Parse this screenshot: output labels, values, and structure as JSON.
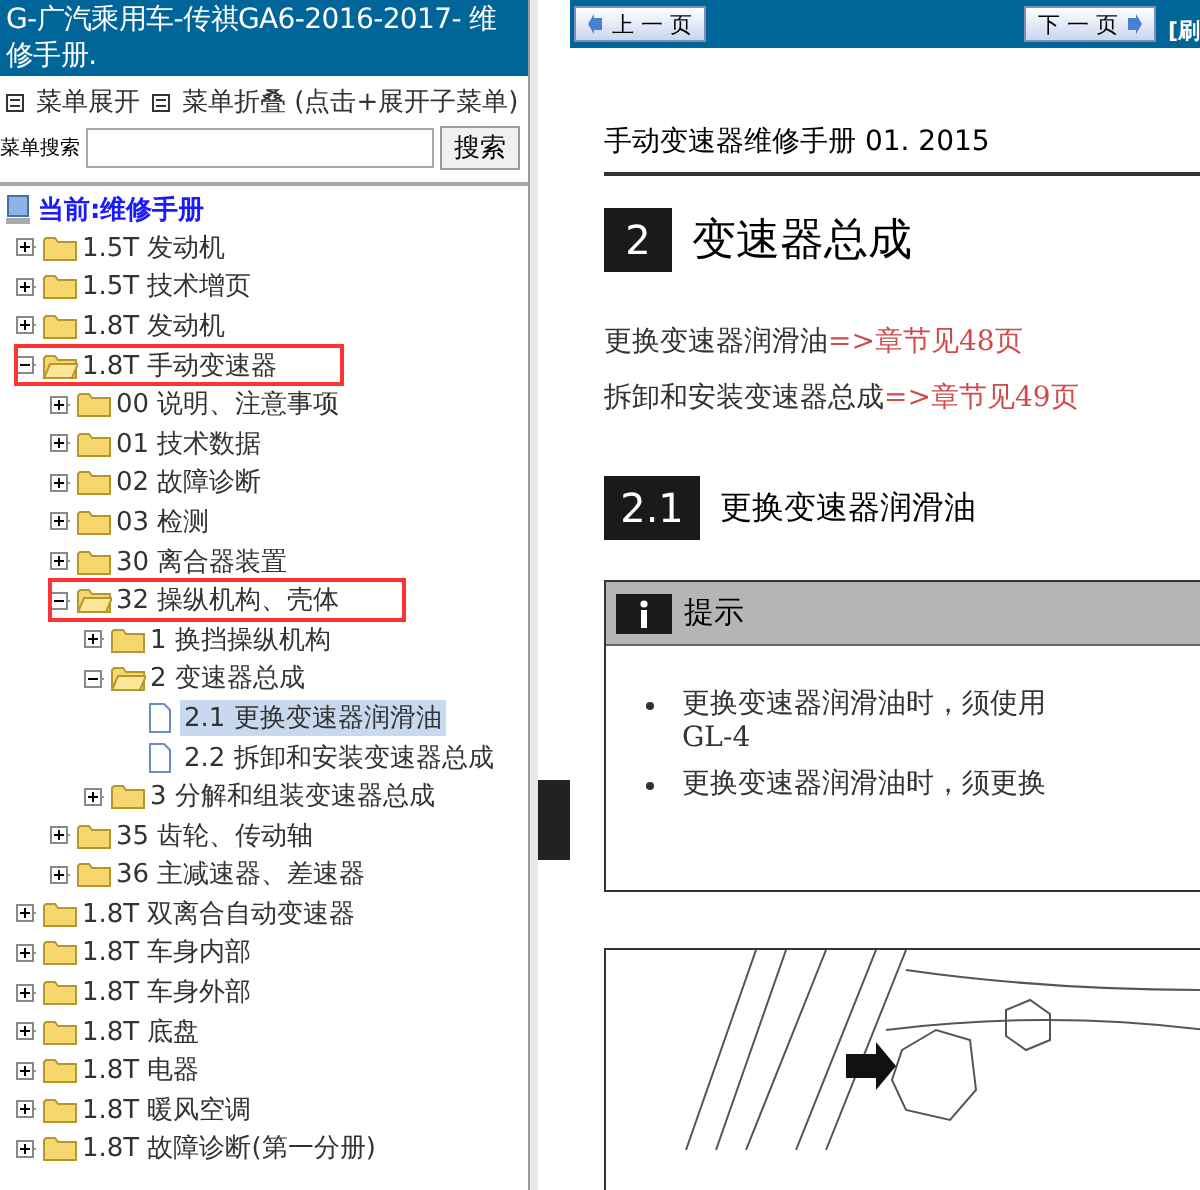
{
  "sidebar": {
    "title": "G-广汽乘用车-传祺GA6-2016-2017- 维修手册.",
    "menu_links": [
      "菜单展开",
      "菜单折叠 (点击+展开子菜单)"
    ],
    "search": {
      "label": "菜单搜索",
      "button": "搜索"
    },
    "tree": {
      "root": "当前:维修手册",
      "items": [
        {
          "kind": "folder",
          "label": "1.5T 发动机",
          "expanded": false,
          "highlighted": false,
          "selected": false
        },
        {
          "kind": "folder",
          "label": "1.5T 技术增页",
          "expanded": false,
          "highlighted": false,
          "selected": false
        },
        {
          "kind": "folder",
          "label": "1.8T 发动机",
          "expanded": false,
          "highlighted": false,
          "selected": false
        },
        {
          "kind": "folder",
          "label": "1.8T 手动变速器",
          "expanded": true,
          "highlighted": true,
          "selected": false,
          "children": [
            {
              "kind": "folder",
              "label": "00 说明、注意事项",
              "expanded": false,
              "highlighted": false,
              "selected": false
            },
            {
              "kind": "folder",
              "label": "01 技术数据",
              "expanded": false,
              "highlighted": false,
              "selected": false
            },
            {
              "kind": "folder",
              "label": "02 故障诊断",
              "expanded": false,
              "highlighted": false,
              "selected": false
            },
            {
              "kind": "folder",
              "label": "03 检测",
              "expanded": false,
              "highlighted": false,
              "selected": false
            },
            {
              "kind": "folder",
              "label": "30 离合器装置",
              "expanded": false,
              "highlighted": false,
              "selected": false
            },
            {
              "kind": "folder",
              "label": "32 操纵机构、壳体",
              "expanded": true,
              "highlighted": true,
              "selected": false,
              "children": [
                {
                  "kind": "folder",
                  "label": "1 换挡操纵机构",
                  "expanded": false,
                  "highlighted": false,
                  "selected": false
                },
                {
                  "kind": "folder",
                  "label": "2 变速器总成",
                  "expanded": true,
                  "highlighted": false,
                  "selected": false,
                  "children": [
                    {
                      "kind": "document",
                      "label": "2.1 更换变速器润滑油",
                      "highlighted": false,
                      "selected": true
                    },
                    {
                      "kind": "document",
                      "label": "2.2 拆卸和安装变速器总成",
                      "highlighted": false,
                      "selected": false
                    }
                  ]
                },
                {
                  "kind": "folder",
                  "label": "3 分解和组装变速器总成",
                  "expanded": false,
                  "highlighted": false,
                  "selected": false
                }
              ]
            },
            {
              "kind": "folder",
              "label": "35 齿轮、传动轴",
              "expanded": false,
              "highlighted": false,
              "selected": false
            },
            {
              "kind": "folder",
              "label": "36 主减速器、差速器",
              "expanded": false,
              "highlighted": false,
              "selected": false
            }
          ]
        },
        {
          "kind": "folder",
          "label": "1.8T 双离合自动变速器",
          "expanded": false,
          "highlighted": false,
          "selected": false
        },
        {
          "kind": "folder",
          "label": "1.8T 车身内部",
          "expanded": false,
          "highlighted": false,
          "selected": false
        },
        {
          "kind": "folder",
          "label": "1.8T 车身外部",
          "expanded": false,
          "highlighted": false,
          "selected": false
        },
        {
          "kind": "folder",
          "label": "1.8T 底盘",
          "expanded": false,
          "highlighted": false,
          "selected": false
        },
        {
          "kind": "folder",
          "label": "1.8T 电器",
          "expanded": false,
          "highlighted": false,
          "selected": false
        },
        {
          "kind": "folder",
          "label": "1.8T 暖风空调",
          "expanded": false,
          "highlighted": false,
          "selected": false
        },
        {
          "kind": "folder",
          "label": "1.8T 故障诊断(第一分册)",
          "expanded": false,
          "highlighted": false,
          "selected": false
        }
      ]
    }
  },
  "viewer": {
    "prev_button": "上 一 页",
    "next_button": "下 一 页",
    "refresh_link": "[刷",
    "page": {
      "running_head": "手动变速器维修手册 01. 2015",
      "chapter": {
        "number": "2",
        "title": "变速器总成"
      },
      "links": [
        {
          "text": "更换变速器润滑油",
          "ref": "=>章节见48页"
        },
        {
          "text": "拆卸和安装变速器总成",
          "ref": "=>章节见49页"
        }
      ],
      "section": {
        "number": "2.1",
        "title": "更换变速器润滑油"
      },
      "note": {
        "title": "提示",
        "bullets": [
          {
            "lines": [
              "更换变速器润滑油时，须使用",
              "GL-4"
            ]
          },
          {
            "lines": [
              "更换变速器润滑油时，须更换"
            ]
          }
        ]
      }
    }
  }
}
